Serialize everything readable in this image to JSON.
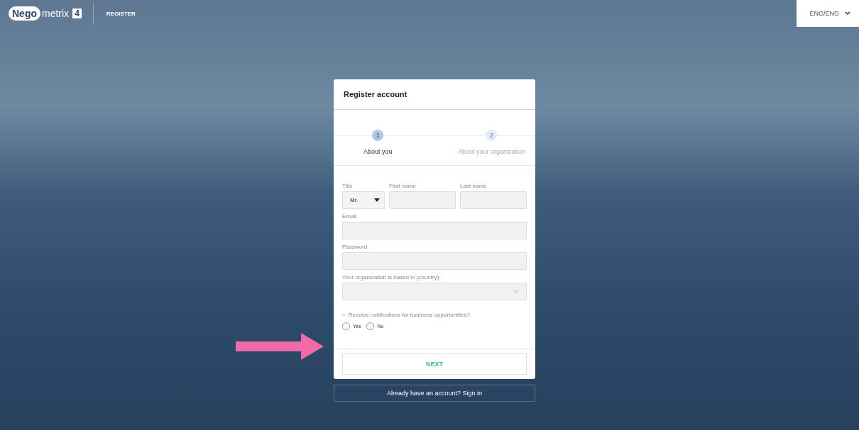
{
  "header": {
    "logo_word": "Nego",
    "logo_rest": "metrix",
    "logo_badge": "4",
    "nav": "REGISTER",
    "language": "ENG/ENG"
  },
  "card": {
    "title": "Register account",
    "steps": [
      {
        "number": "1",
        "label": "About you",
        "selected": true
      },
      {
        "number": "2",
        "label": "About your organization",
        "selected": false
      }
    ],
    "name_row": [
      {
        "kind": "select",
        "label": "Title",
        "value": "Mr."
      },
      {
        "kind": "text",
        "label": "First name"
      },
      {
        "kind": "text",
        "label": "Last name"
      }
    ],
    "fields": [
      {
        "kind": "text",
        "label": "Email"
      },
      {
        "kind": "text",
        "label": "Password"
      },
      {
        "kind": "dropdown",
        "label": "Your organization is based in (country):"
      }
    ],
    "question": {
      "required_mark": "×",
      "label": "Receive notifications for business opportunities?",
      "options": [
        {
          "label": "Yes",
          "selected": false
        },
        {
          "label": "No",
          "selected": false
        }
      ]
    },
    "button": "NEXT"
  },
  "signin": "Already have an account? Sign in"
}
